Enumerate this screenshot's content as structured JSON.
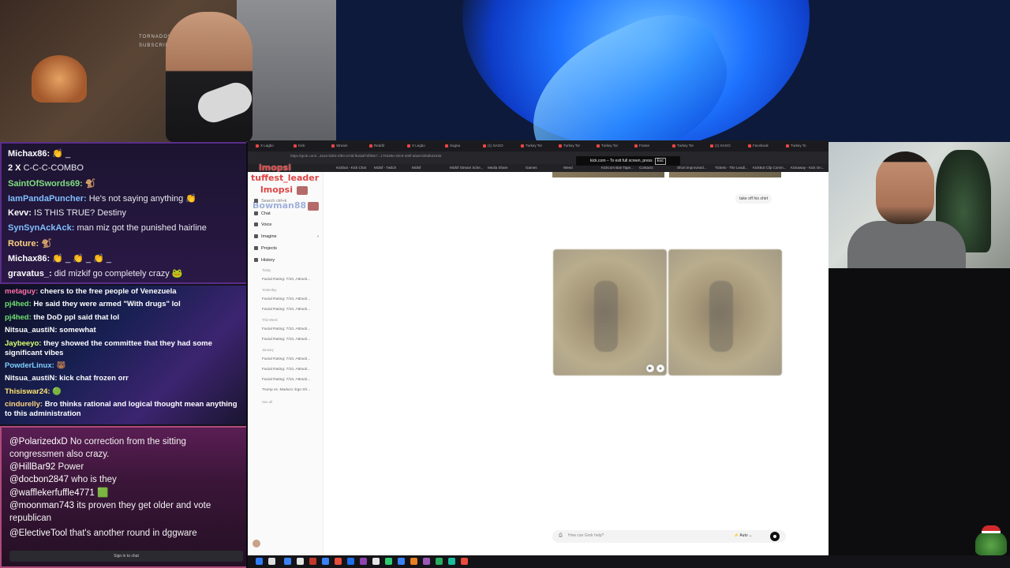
{
  "stream": {
    "webcam_poster_lines": [
      "TORNADOVERNER",
      "SUBSCRIBER"
    ]
  },
  "chat_top": [
    {
      "user": "Michax86:",
      "text": "👏 _",
      "color": "#ffffff"
    },
    {
      "user": "2 X",
      "text": "C-C-C-COMBO",
      "color": "#ffffff"
    },
    {
      "user": "SaintOfSwords69:",
      "text": "🐒",
      "color": "#7fe07f"
    },
    {
      "user": "IamPandaPuncher:",
      "text": "He's not saying anything 👏",
      "color": "#7fbfff"
    },
    {
      "user": "Kevv:",
      "text": "IS THIS TRUE? Destiny",
      "color": "#ffffff"
    },
    {
      "user": "SynSynAckAck:",
      "text": "man miz got the punished hairline",
      "color": "#7fbfff"
    },
    {
      "user": "Roture:",
      "text": "🐒",
      "color": "#ffd27f"
    },
    {
      "user": "Michax86:",
      "text": "👏 _ 👏 _ 👏 _",
      "color": "#ffffff"
    },
    {
      "user": "gravatus_:",
      "text": "did mizkif go completely crazy 🐸",
      "color": "#ffffff"
    }
  ],
  "chat_mid": [
    {
      "user": "metaguy:",
      "text": "cheers to the free people of Venezuela",
      "color": "#ff6fa8"
    },
    {
      "user": "pj4hed:",
      "text": "He said they were armed \"With drugs\" lol",
      "color": "#6fe06f"
    },
    {
      "user": "pj4hed:",
      "text": "the DoD ppl said that lol",
      "color": "#6fe06f"
    },
    {
      "user": "Nitsua_austiN:",
      "text": "somewhat",
      "color": "#ffffff"
    },
    {
      "user": "Jaybeeyo:",
      "text": "they showed the committee that they had some significant vibes",
      "color": "#d8ff6f"
    },
    {
      "user": "PowderLinux:",
      "text": "🐻",
      "color": "#7fd0ff"
    },
    {
      "user": "Nitsua_austiN:",
      "text": "kick chat frozen orr",
      "color": "#ffffff"
    },
    {
      "user": "Thisiswar24:",
      "text": "🟢",
      "color": "#ffe56f"
    },
    {
      "user": "cindurelly:",
      "text": "Bro thinks rational and logical thought mean anything to this administration",
      "color": "#ffd27f"
    }
  ],
  "chat_bottom": [
    {
      "user": "@PolarizedxD",
      "text": "No correction from the sitting congressmen also crazy."
    },
    {
      "user": "@HillBar92",
      "text": "Power"
    },
    {
      "user": "@docbon2847",
      "text": "who is they"
    },
    {
      "user": "@wafflekerfuffle4771",
      "text": "🟩"
    },
    {
      "user": "@moonman743",
      "text": "its proven they get older and vote republican"
    },
    {
      "user": "@ElectiveTool",
      "text": "that's another round in dggware"
    }
  ],
  "chat_signin": "Sign in to chat",
  "browser": {
    "tabs": [
      "X Lagbo",
      "Kick",
      "Stream",
      "Reddit",
      "X Legbo",
      "Sogna",
      "(1) SAGO",
      "Turkey Tor",
      "Turkey Tor",
      "Turkey Tor",
      "Frame",
      "Turkey Tor",
      "(1) SAGO",
      "Facebook",
      "Turkey To"
    ],
    "url": "https://grok.com/...3a16-bd03-4f50-a7dd-f62daf7df08e?...176329e-20c9-400f-aba6-b0bdb31935",
    "bookmarks": [
      "Kickbot - Kick Chat",
      "Mizkif - Twitch",
      "Mizkif",
      "Mizkif Stream Sche...",
      "Media Share",
      "Games",
      "Weed",
      "Kickcom Ban Tape...",
      "Contacts",
      "Short improvised...",
      "Tickets - The Leadi...",
      "KickBot Clip Comm...",
      "Kickaway - Kick On..."
    ],
    "fullscreen_toast": "kick.com – To exit full screen, press",
    "fullscreen_key": "Esc"
  },
  "grok_sidebar": {
    "emote_labels": [
      "tuffest_leader",
      "lmopsi",
      "lmopsi",
      "Bowman88"
    ],
    "search": "Search ctrl+k",
    "items": [
      "Chat",
      "Voice",
      "Imagine",
      "Projects",
      "History"
    ],
    "history": [
      {
        "head": "Today",
        "entries": [
          "Facial Rating: 7/10, Attracti..."
        ]
      },
      {
        "head": "Yesterday",
        "entries": [
          "Facial Rating: 7/10, Attracti...",
          "Facial Rating: 7/10, Attracti..."
        ]
      },
      {
        "head": "This Week",
        "entries": [
          "Facial Rating: 7/10, Attracti...",
          "Facial Rating: 7/10, Attracti..."
        ]
      },
      {
        "head": "January",
        "entries": [
          "Facial Rating: 7/10, Attracti...",
          "Facial Rating: 7/10, Attracti...",
          "Facial Rating: 7/10, Attracti...",
          "Trump vs. Maduro: Ego Sh..."
        ]
      }
    ],
    "see_all": "See all"
  },
  "grok_main": {
    "prompt": "take off his shirt",
    "composer_placeholder": "How can Grok help?",
    "mode": "Auto"
  },
  "taskbar": {
    "icons": [
      "#3b82f6",
      "#e5e5e5",
      "#c0392b",
      "#3b82f6",
      "#e74c3c",
      "#1f6feb",
      "#8e44ad",
      "#e5e5e5",
      "#2ecc71",
      "#3b82f6",
      "#e67e22",
      "#9b59b6",
      "#27ae60",
      "#1abc9c",
      "#e74c3c"
    ]
  }
}
